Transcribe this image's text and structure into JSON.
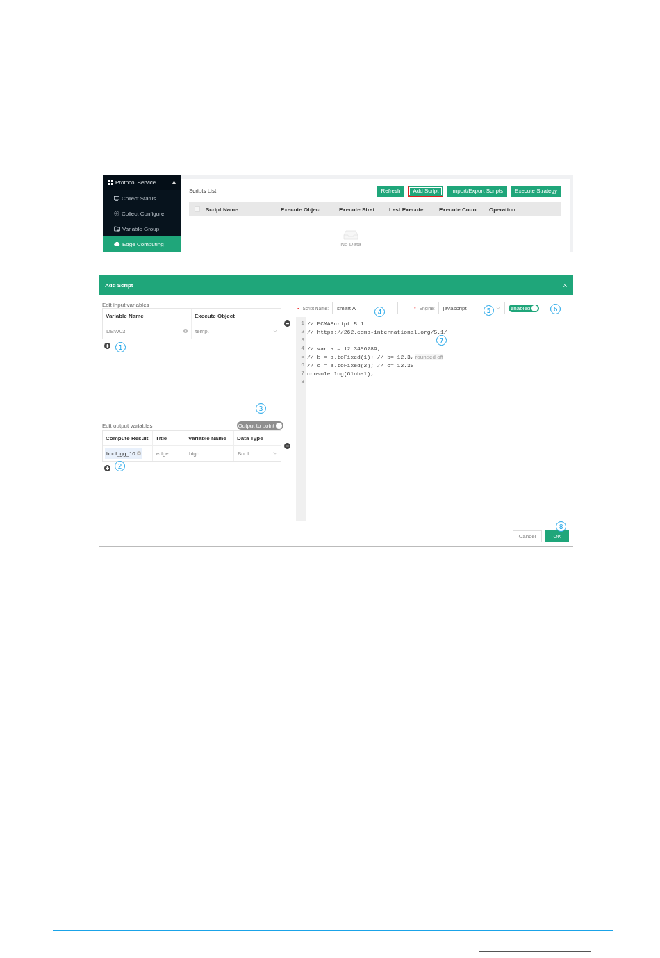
{
  "app_screen": {
    "sidebar": {
      "group": {
        "label": "Protocol Service",
        "expanded": true
      },
      "items": [
        {
          "label": "Collect Status",
          "selected": false
        },
        {
          "label": "Collect Configure",
          "selected": false
        },
        {
          "label": "Variable Group",
          "selected": false
        },
        {
          "label": "Edge Computing",
          "selected": true
        }
      ]
    },
    "panel": {
      "title": "Scripts List",
      "buttons": [
        {
          "label": "Refresh",
          "highlighted": false
        },
        {
          "label": "Add Script",
          "highlighted": true
        },
        {
          "label": "Import/Export Scripts",
          "highlighted": false
        },
        {
          "label": "Execute Strategy",
          "highlighted": false
        }
      ],
      "table": {
        "select_all": {
          "checked": false
        },
        "columns": [
          "Script Name",
          "Execute Object",
          "Execute Strat...",
          "Last Execute ...",
          "Execute Count",
          "Operation"
        ],
        "empty_text": "No Data"
      }
    }
  },
  "dialog": {
    "title": "Add Script",
    "close": "X",
    "input_section": {
      "label": "Edit input variables",
      "columns": [
        "Variable Name",
        "Execute Object"
      ],
      "rows": [
        {
          "variable_name": "DBW03",
          "execute_object": "temp."
        }
      ]
    },
    "output_section": {
      "label": "Edit output variables",
      "toggle": {
        "label": "Output to point",
        "on": false
      },
      "columns": [
        "Compute Result",
        "Title",
        "Variable Name",
        "Data Type"
      ],
      "rows": [
        {
          "compute_result": "bool_gg_10",
          "title": "edge",
          "variable_name": "high",
          "data_type": "Bool"
        }
      ]
    },
    "script_name": {
      "required_mark": "•",
      "label": "Script Name:",
      "value": "smart A"
    },
    "engine": {
      "required_mark": "*",
      "label": "Engine:",
      "value": "javascript"
    },
    "enabled_toggle": {
      "label": "enabled",
      "on": true
    },
    "code_lines": [
      {
        "number": "1",
        "text": "// ECMAScript 5.1"
      },
      {
        "number": "2",
        "text": "// https://262.ecma-international.org/5.1/"
      },
      {
        "number": "3"
      },
      {
        "number": "4",
        "text": "// var a = 12.3456789;"
      },
      {
        "number": "5",
        "text": "// b = a.toFixed(1); // b= 12.3,",
        "note": "rounded off"
      },
      {
        "number": "6",
        "text": "// c = a.toFixed(2); // c= 12.35"
      },
      {
        "number": "7",
        "text": "console.log(Global);"
      },
      {
        "number": "8"
      }
    ],
    "buttons": [
      {
        "label": "Cancel",
        "primary": false
      },
      {
        "label": "OK",
        "primary": true
      }
    ]
  },
  "callouts": [
    "1",
    "2",
    "3",
    "4",
    "5",
    "6",
    "7",
    "8"
  ]
}
